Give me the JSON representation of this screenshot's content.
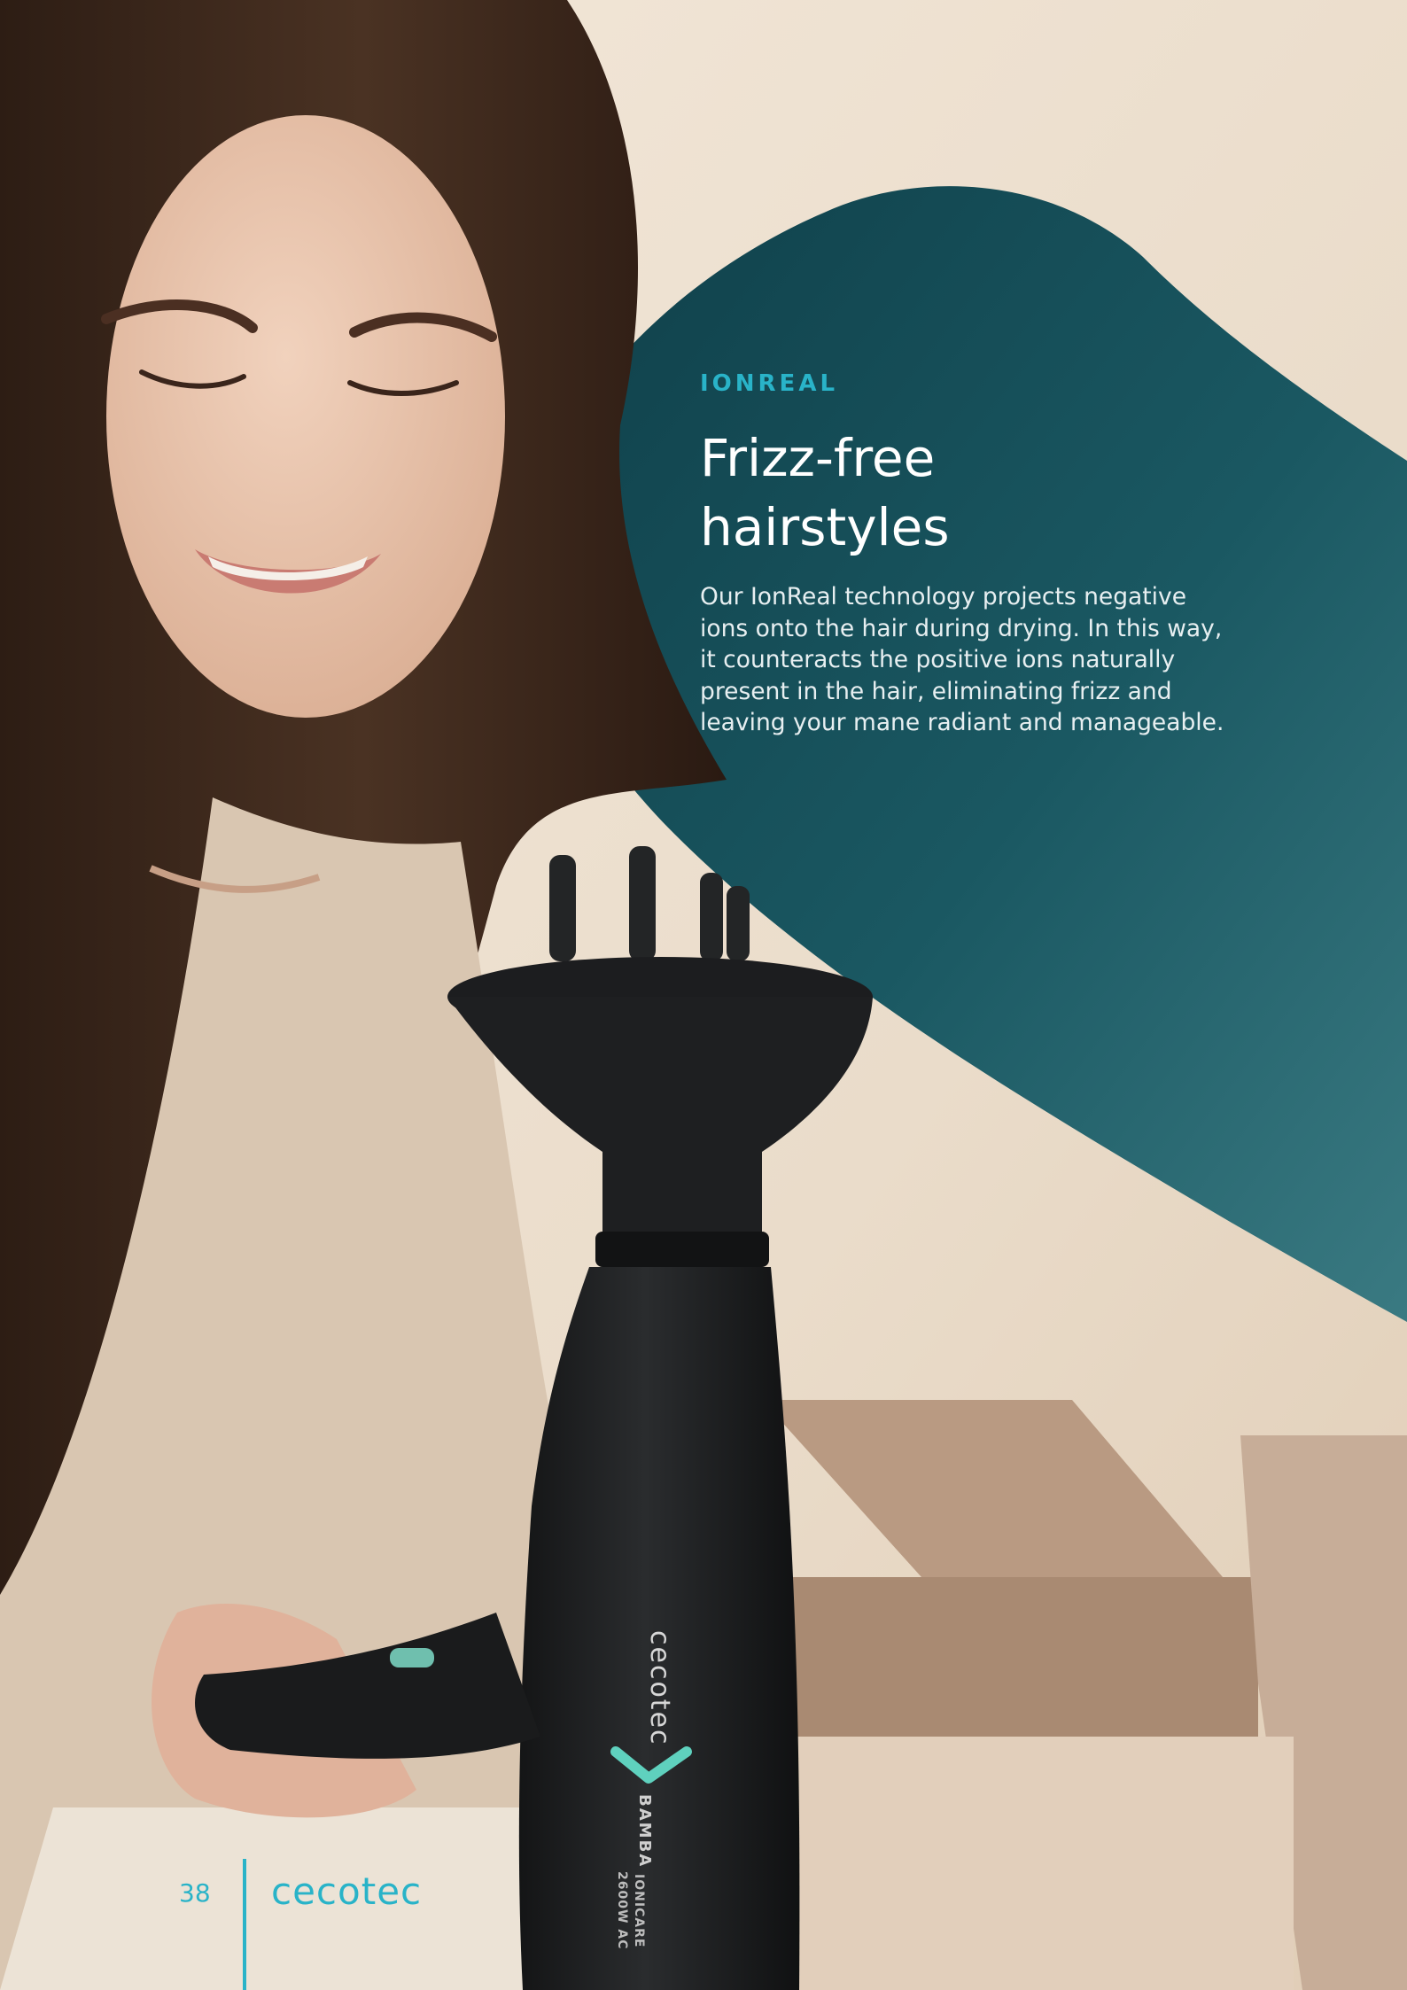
{
  "feature": {
    "kicker": "IONREAL",
    "headline_line1": "Frizz-free",
    "headline_line2": "hairstyles",
    "body_lines": [
      "Our IonReal technology projects negative",
      "ions onto the hair during drying. In this way,",
      "it counteracts the positive ions naturally",
      "present in the hair, eliminating frizz and",
      "leaving your mane radiant and manageable."
    ]
  },
  "footer": {
    "page_number": "38",
    "brand": "cecotec"
  },
  "product": {
    "brand": "cecotec",
    "model": "BAMBA",
    "line": "IONICARE",
    "spec": "2600W AC"
  },
  "colors": {
    "accent": "#29b3c8",
    "panel": "#124650",
    "background": "#eadcc9"
  },
  "icons": [
    "cecotec-chevron-icon"
  ]
}
